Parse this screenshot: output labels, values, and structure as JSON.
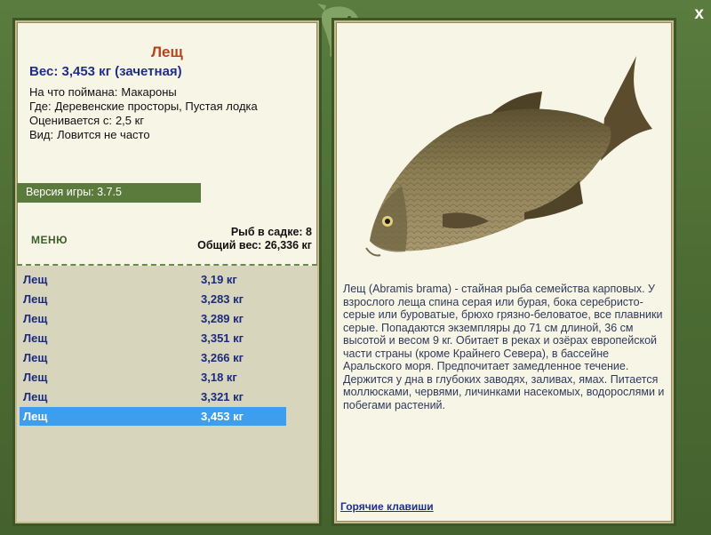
{
  "fish": {
    "name": "Лещ",
    "weight_line": "Вес: 3,453 кг (зачетная)",
    "details": [
      {
        "label": "На что поймана:",
        "value": "Макароны"
      },
      {
        "label": "Где:",
        "value": "Деревенские просторы, Пустая лодка"
      },
      {
        "label": "Оценивается с:",
        "value": "2,5 кг"
      },
      {
        "label": "Вид:",
        "value": "Ловится не часто"
      }
    ]
  },
  "version": "Версия игры: 3.7.5",
  "menu_label": "МЕНЮ",
  "stats": {
    "count": "Рыб в садке: 8",
    "total": "Общий вес: 26,336 кг"
  },
  "catch_list": [
    {
      "name": "Лещ",
      "weight": "3,19 кг"
    },
    {
      "name": "Лещ",
      "weight": "3,283 кг"
    },
    {
      "name": "Лещ",
      "weight": "3,289 кг"
    },
    {
      "name": "Лещ",
      "weight": "3,351 кг"
    },
    {
      "name": "Лещ",
      "weight": "3,266 кг"
    },
    {
      "name": "Лещ",
      "weight": "3,18 кг"
    },
    {
      "name": "Лещ",
      "weight": "3,321 кг"
    },
    {
      "name": "Лещ",
      "weight": "3,453 кг"
    }
  ],
  "selected_index": 7,
  "description": "Лещ (Abramis brama) - стайная рыба семейства карповых. У взрослого леща спина серая или бурая, бока серебристо-серые или буроватые, брюхо грязно-беловатое, все плавники серые. Попадаются экземпляры до 71 см длиной, 36 см высотой и весом 9 кг. Обитает в реках и озёрах европейской части страны (кроме Крайнего Севера), в бассейне Аральского моря. Предпочитает замедленное течение. Держится у дна в глубоких заводях, заливах, ямах. Питается моллюсками, червями, личинками насекомых, водорослями и побегами растений.",
  "hotkeys_link": "Горячие клавиши",
  "close_glyph": "x",
  "colors": {
    "frame": "#4c6c34",
    "panel_bg": "#f7f5e6",
    "title": "#b5431b",
    "link": "#1f2f8d",
    "selection": "#3d9ef0"
  },
  "icons": [
    "fish-logo-icon",
    "close-icon",
    "bream-fish-image"
  ]
}
